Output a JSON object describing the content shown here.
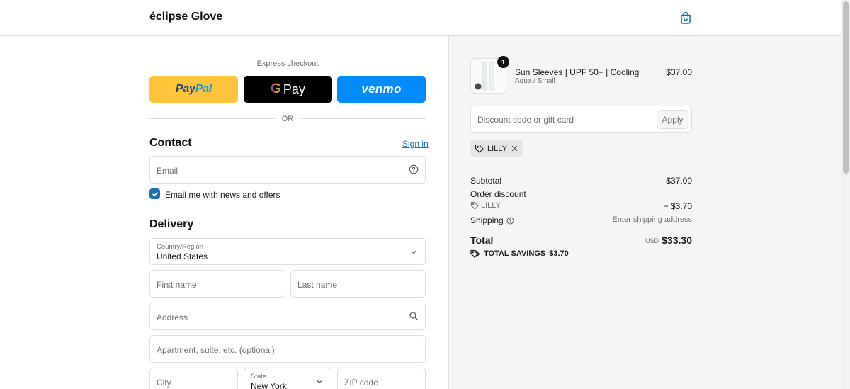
{
  "header": {
    "brand": "éclipse Glove",
    "cart_icon": "shopping-bag-icon"
  },
  "express": {
    "title": "Express checkout",
    "paypal_a": "Pay",
    "paypal_b": "Pal",
    "gpay_label": "Pay",
    "venmo_label": "venmo",
    "divider": "OR"
  },
  "contact": {
    "title": "Contact",
    "signin": "Sign in",
    "email_placeholder": "Email",
    "newsletter_label": "Email me with news and offers",
    "newsletter_checked": true
  },
  "delivery": {
    "title": "Delivery",
    "country_label": "Country/Region",
    "country_value": "United States",
    "first_name": "First name",
    "last_name": "Last name",
    "address": "Address",
    "apartment": "Apartment, suite, etc. (optional)",
    "city": "City",
    "state_label": "State",
    "state_value": "New York",
    "zip": "ZIP code"
  },
  "summary": {
    "item": {
      "quantity": "1",
      "name": "Sun Sleeves | UPF 50+ | Cooling",
      "variant": "Aqua / Small",
      "price": "$37.00"
    },
    "discount_placeholder": "Discount code or gift card",
    "apply_label": "Apply",
    "applied_code": "LILLY",
    "subtotal_label": "Subtotal",
    "subtotal_value": "$37.00",
    "order_discount_label": "Order discount",
    "discount_code": "LILLY",
    "discount_value": "− $3.70",
    "shipping_label": "Shipping",
    "shipping_value": "Enter shipping address",
    "total_label": "Total",
    "total_currency": "USD",
    "total_value": "$33.30",
    "savings_label": "TOTAL SAVINGS",
    "savings_value": "$3.70"
  },
  "colors": {
    "accent": "#1773b0",
    "paypal": "#ffc439",
    "venmo": "#008cff",
    "summary_bg": "#f5f5f5"
  }
}
